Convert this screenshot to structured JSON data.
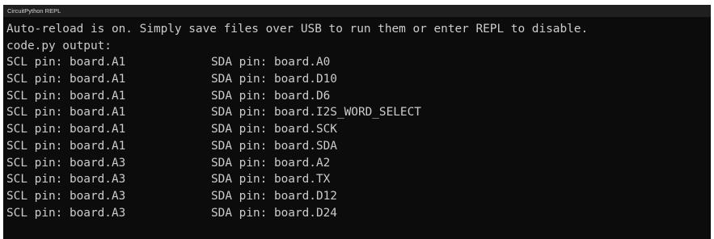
{
  "window": {
    "title": "CircuitPython REPL"
  },
  "terminal": {
    "lines": [
      "Auto-reload is on. Simply save files over USB to run them or enter REPL to disable.",
      "code.py output:"
    ],
    "rows": [
      {
        "scl": "SCL pin: board.A1",
        "sda": "SDA pin: board.A0"
      },
      {
        "scl": "SCL pin: board.A1",
        "sda": "SDA pin: board.D10"
      },
      {
        "scl": "SCL pin: board.A1",
        "sda": "SDA pin: board.D6"
      },
      {
        "scl": "SCL pin: board.A1",
        "sda": "SDA pin: board.I2S_WORD_SELECT"
      },
      {
        "scl": "SCL pin: board.A1",
        "sda": "SDA pin: board.SCK"
      },
      {
        "scl": "SCL pin: board.A1",
        "sda": "SDA pin: board.SDA"
      },
      {
        "scl": "SCL pin: board.A3",
        "sda": "SDA pin: board.A2"
      },
      {
        "scl": "SCL pin: board.A3",
        "sda": "SDA pin: board.TX"
      },
      {
        "scl": "SCL pin: board.A3",
        "sda": "SDA pin: board.D12"
      },
      {
        "scl": "SCL pin: board.A3",
        "sda": "SDA pin: board.D24"
      }
    ]
  },
  "colors": {
    "background": "#0c0c0c",
    "titlebar": "#1f1f1f",
    "text": "#cccccc"
  }
}
